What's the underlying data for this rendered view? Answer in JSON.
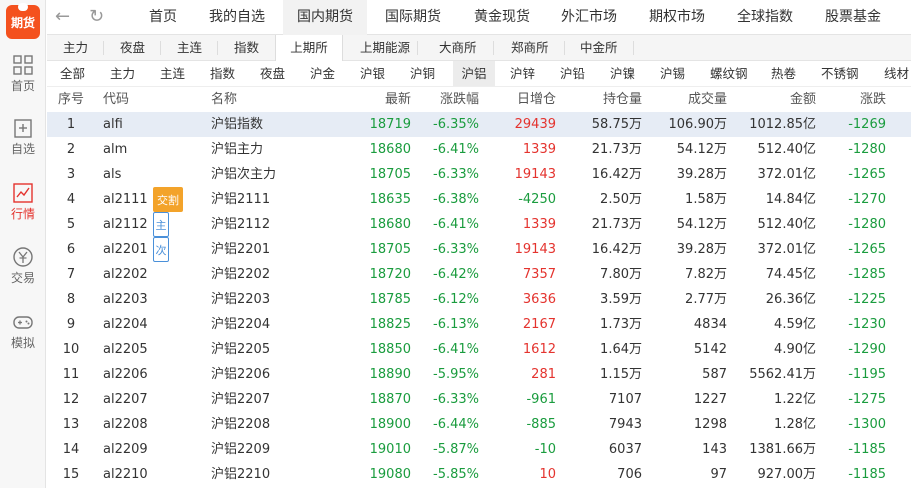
{
  "app": {
    "logo_text": "期货"
  },
  "sidebar": {
    "items": [
      {
        "label": "首页",
        "icon": "grid-icon"
      },
      {
        "label": "自选",
        "icon": "add-list-icon"
      },
      {
        "label": "行情",
        "icon": "chart-icon",
        "active": true
      },
      {
        "label": "交易",
        "icon": "yen-icon"
      },
      {
        "label": "模拟",
        "icon": "gamepad-icon"
      }
    ]
  },
  "topnav": {
    "tabs": [
      "首页",
      "我的自选",
      "国内期货",
      "国际期货",
      "黄金现货",
      "外汇市场",
      "期权市场",
      "全球指数",
      "股票基金"
    ],
    "active": "国内期货"
  },
  "exchange_bar": {
    "items": [
      "主力",
      "夜盘",
      "主连",
      "指数",
      "上期所",
      "上期能源",
      "大商所",
      "郑商所",
      "中金所"
    ],
    "active": "上期所"
  },
  "category_bar": {
    "items": [
      "全部",
      "主力",
      "主连",
      "指数",
      "夜盘",
      "沪金",
      "沪银",
      "沪铜",
      "沪铝",
      "沪锌",
      "沪铅",
      "沪镍",
      "沪锡",
      "螺纹钢",
      "热卷",
      "不锈钢",
      "线材"
    ],
    "active": "沪铝"
  },
  "table": {
    "headers": [
      "序号",
      "代码",
      "名称",
      "最新",
      "涨跌幅",
      "日增仓",
      "持仓量",
      "成交量",
      "金额",
      "涨跌"
    ],
    "rows": [
      {
        "no": "1",
        "code": "alfi",
        "badge": "",
        "name": "沪铝指数",
        "last": "18719",
        "pct": "-6.35%",
        "dinc": "29439",
        "dinc_dir": "up",
        "oi": "58.75万",
        "vol": "106.90万",
        "amt": "1012.85亿",
        "chg": "-1269",
        "selected": true
      },
      {
        "no": "2",
        "code": "alm",
        "badge": "",
        "name": "沪铝主力",
        "last": "18680",
        "pct": "-6.41%",
        "dinc": "1339",
        "dinc_dir": "up",
        "oi": "21.73万",
        "vol": "54.12万",
        "amt": "512.40亿",
        "chg": "-1280"
      },
      {
        "no": "3",
        "code": "als",
        "badge": "",
        "name": "沪铝次主力",
        "last": "18705",
        "pct": "-6.33%",
        "dinc": "19143",
        "dinc_dir": "up",
        "oi": "16.42万",
        "vol": "39.28万",
        "amt": "372.01亿",
        "chg": "-1265"
      },
      {
        "no": "4",
        "code": "al2111",
        "badge": "交割",
        "badge_style": "orange",
        "name": "沪铝2111",
        "last": "18635",
        "pct": "-6.38%",
        "dinc": "-4250",
        "dinc_dir": "down",
        "oi": "2.50万",
        "vol": "1.58万",
        "amt": "14.84亿",
        "chg": "-1270"
      },
      {
        "no": "5",
        "code": "al2112",
        "badge": "主",
        "badge_style": "blue",
        "name": "沪铝2112",
        "last": "18680",
        "pct": "-6.41%",
        "dinc": "1339",
        "dinc_dir": "up",
        "oi": "21.73万",
        "vol": "54.12万",
        "amt": "512.40亿",
        "chg": "-1280"
      },
      {
        "no": "6",
        "code": "al2201",
        "badge": "次",
        "badge_style": "blue",
        "name": "沪铝2201",
        "last": "18705",
        "pct": "-6.33%",
        "dinc": "19143",
        "dinc_dir": "up",
        "oi": "16.42万",
        "vol": "39.28万",
        "amt": "372.01亿",
        "chg": "-1265"
      },
      {
        "no": "7",
        "code": "al2202",
        "badge": "",
        "name": "沪铝2202",
        "last": "18720",
        "pct": "-6.42%",
        "dinc": "7357",
        "dinc_dir": "up",
        "oi": "7.80万",
        "vol": "7.82万",
        "amt": "74.45亿",
        "chg": "-1285"
      },
      {
        "no": "8",
        "code": "al2203",
        "badge": "",
        "name": "沪铝2203",
        "last": "18785",
        "pct": "-6.12%",
        "dinc": "3636",
        "dinc_dir": "up",
        "oi": "3.59万",
        "vol": "2.77万",
        "amt": "26.36亿",
        "chg": "-1225"
      },
      {
        "no": "9",
        "code": "al2204",
        "badge": "",
        "name": "沪铝2204",
        "last": "18825",
        "pct": "-6.13%",
        "dinc": "2167",
        "dinc_dir": "up",
        "oi": "1.73万",
        "vol": "4834",
        "amt": "4.59亿",
        "chg": "-1230"
      },
      {
        "no": "10",
        "code": "al2205",
        "badge": "",
        "name": "沪铝2205",
        "last": "18850",
        "pct": "-6.41%",
        "dinc": "1612",
        "dinc_dir": "up",
        "oi": "1.64万",
        "vol": "5142",
        "amt": "4.90亿",
        "chg": "-1290"
      },
      {
        "no": "11",
        "code": "al2206",
        "badge": "",
        "name": "沪铝2206",
        "last": "18890",
        "pct": "-5.95%",
        "dinc": "281",
        "dinc_dir": "up",
        "oi": "1.15万",
        "vol": "587",
        "amt": "5562.41万",
        "chg": "-1195"
      },
      {
        "no": "12",
        "code": "al2207",
        "badge": "",
        "name": "沪铝2207",
        "last": "18870",
        "pct": "-6.33%",
        "dinc": "-961",
        "dinc_dir": "down",
        "oi": "7107",
        "vol": "1227",
        "amt": "1.22亿",
        "chg": "-1275"
      },
      {
        "no": "13",
        "code": "al2208",
        "badge": "",
        "name": "沪铝2208",
        "last": "18900",
        "pct": "-6.44%",
        "dinc": "-885",
        "dinc_dir": "down",
        "oi": "7943",
        "vol": "1298",
        "amt": "1.28亿",
        "chg": "-1300"
      },
      {
        "no": "14",
        "code": "al2209",
        "badge": "",
        "name": "沪铝2209",
        "last": "19010",
        "pct": "-5.87%",
        "dinc": "-10",
        "dinc_dir": "down",
        "oi": "6037",
        "vol": "143",
        "amt": "1381.66万",
        "chg": "-1185"
      },
      {
        "no": "15",
        "code": "al2210",
        "badge": "",
        "name": "沪铝2210",
        "last": "19080",
        "pct": "-5.85%",
        "dinc": "10",
        "dinc_dir": "up",
        "oi": "706",
        "vol": "97",
        "amt": "927.00万",
        "chg": "-1185"
      }
    ]
  },
  "colors": {
    "up": "#e4332e",
    "down": "#1a9c3e",
    "accent": "#f4511e",
    "selected_row": "#e6ecf5"
  }
}
